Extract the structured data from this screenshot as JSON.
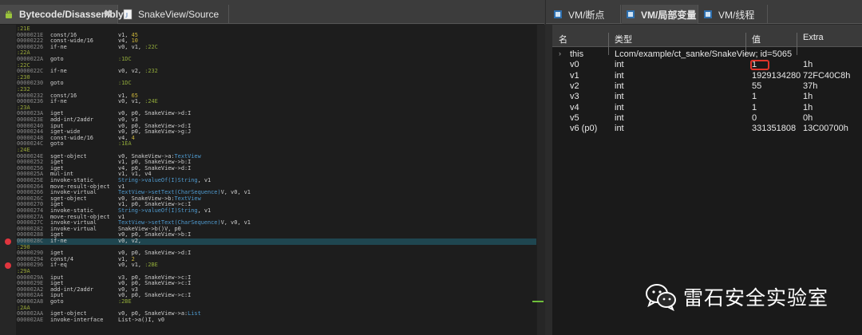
{
  "left_tabs": [
    {
      "label": "Bytecode/Disassembly",
      "active": true
    },
    {
      "label": "SnakeView/Source",
      "active": false
    }
  ],
  "code_lines": [
    {
      "type": "label",
      "text": ":21E"
    },
    {
      "addr": "0000021E",
      "op": "const/16",
      "args": [
        {
          "t": "v1, "
        },
        {
          "t": "45",
          "c": "k"
        }
      ]
    },
    {
      "addr": "00000222",
      "op": "const-wide/16",
      "args": [
        {
          "t": "v4, "
        },
        {
          "t": "10",
          "c": "k"
        }
      ]
    },
    {
      "addr": "00000226",
      "op": "if-ne",
      "args": [
        {
          "t": "v0, v1, "
        },
        {
          "t": ":22C",
          "c": "g"
        }
      ]
    },
    {
      "type": "label",
      "text": ":22A"
    },
    {
      "addr": "0000022A",
      "op": "goto",
      "args": [
        {
          "t": ":1DC",
          "c": "g"
        }
      ]
    },
    {
      "type": "label",
      "text": ":22C"
    },
    {
      "addr": "0000022C",
      "op": "if-ne",
      "args": [
        {
          "t": "v0, v2, "
        },
        {
          "t": ":232",
          "c": "g"
        }
      ]
    },
    {
      "type": "label",
      "text": ":230"
    },
    {
      "addr": "00000230",
      "op": "goto",
      "args": [
        {
          "t": ":1DC",
          "c": "g"
        }
      ]
    },
    {
      "type": "label",
      "text": ":232"
    },
    {
      "addr": "00000232",
      "op": "const/16",
      "args": [
        {
          "t": "v1, "
        },
        {
          "t": "65",
          "c": "k"
        }
      ]
    },
    {
      "addr": "00000236",
      "op": "if-ne",
      "args": [
        {
          "t": "v0, v1, "
        },
        {
          "t": ":24E",
          "c": "g"
        }
      ]
    },
    {
      "type": "label",
      "text": ":23A"
    },
    {
      "addr": "0000023A",
      "op": "iget",
      "args": [
        {
          "t": "v0, p0, SnakeView->d:I"
        }
      ]
    },
    {
      "addr": "0000023E",
      "op": "add-int/2addr",
      "args": [
        {
          "t": "v0, v3"
        }
      ]
    },
    {
      "addr": "00000240",
      "op": "iput",
      "args": [
        {
          "t": "v0, p0, SnakeView->d:I"
        }
      ]
    },
    {
      "addr": "00000244",
      "op": "iget-wide",
      "args": [
        {
          "t": "v0, p0, SnakeView->g:J"
        }
      ]
    },
    {
      "addr": "00000248",
      "op": "const-wide/16",
      "args": [
        {
          "t": "v4, "
        },
        {
          "t": "4",
          "c": "k"
        }
      ]
    },
    {
      "addr": "0000024C",
      "op": "goto",
      "args": [
        {
          "t": ":1EA",
          "c": "g"
        }
      ]
    },
    {
      "type": "label",
      "text": ":24E"
    },
    {
      "addr": "0000024E",
      "op": "sget-object",
      "args": [
        {
          "t": "v0, SnakeView->a:"
        },
        {
          "t": "TextView",
          "c": "m"
        }
      ]
    },
    {
      "addr": "00000252",
      "op": "iget",
      "args": [
        {
          "t": "v1, p0, SnakeView->b:I"
        }
      ]
    },
    {
      "addr": "00000256",
      "op": "iget",
      "args": [
        {
          "t": "v4, p0, SnakeView->d:I"
        }
      ]
    },
    {
      "addr": "0000025A",
      "op": "mul-int",
      "args": [
        {
          "t": "v1, v1, v4"
        }
      ]
    },
    {
      "addr": "0000025E",
      "op": "invoke-static",
      "args": [
        {
          "t": "String->valueOf(I)String",
          "c": "m"
        },
        {
          "t": ", v1"
        }
      ]
    },
    {
      "addr": "00000264",
      "op": "move-result-object",
      "args": [
        {
          "t": "v1"
        }
      ]
    },
    {
      "addr": "00000266",
      "op": "invoke-virtual",
      "args": [
        {
          "t": "TextView->setText(CharSequence)",
          "c": "m"
        },
        {
          "t": "V, v0, v1"
        }
      ]
    },
    {
      "addr": "0000026C",
      "op": "sget-object",
      "args": [
        {
          "t": "v0, SnakeView->b:"
        },
        {
          "t": "TextView",
          "c": "m"
        }
      ]
    },
    {
      "addr": "00000270",
      "op": "iget",
      "args": [
        {
          "t": "v1, p0, SnakeView->c:I"
        }
      ]
    },
    {
      "addr": "00000274",
      "op": "invoke-static",
      "args": [
        {
          "t": "String->valueOf(I)String",
          "c": "m"
        },
        {
          "t": ", v1"
        }
      ]
    },
    {
      "addr": "0000027A",
      "op": "move-result-object",
      "args": [
        {
          "t": "v1"
        }
      ]
    },
    {
      "addr": "0000027C",
      "op": "invoke-virtual",
      "args": [
        {
          "t": "TextView->setText(CharSequence)",
          "c": "m"
        },
        {
          "t": "V, v0, v1"
        }
      ]
    },
    {
      "addr": "00000282",
      "op": "invoke-virtual",
      "args": [
        {
          "t": "SnakeView->b()V, p0"
        }
      ]
    },
    {
      "addr": "00000288",
      "op": "iget",
      "args": [
        {
          "t": "v0, p0, SnakeView->b:I"
        }
      ]
    },
    {
      "addr": "0000028C",
      "op": "if-ne",
      "args": [
        {
          "t": "v0, v2, "
        }
      ],
      "hl": true,
      "bp": true
    },
    {
      "type": "label",
      "text": ":290"
    },
    {
      "addr": "00000290",
      "op": "iget",
      "args": [
        {
          "t": "v0, p0, SnakeView->d:I"
        }
      ]
    },
    {
      "addr": "00000294",
      "op": "const/4",
      "args": [
        {
          "t": "v1, "
        },
        {
          "t": "2",
          "c": "k"
        }
      ]
    },
    {
      "addr": "00000296",
      "op": "if-eq",
      "args": [
        {
          "t": "v0, v1, "
        },
        {
          "t": ":2BE",
          "c": "g"
        }
      ],
      "bp": true
    },
    {
      "type": "label",
      "text": ":29A"
    },
    {
      "addr": "0000029A",
      "op": "iput",
      "args": [
        {
          "t": "v3, p0, SnakeView->c:I"
        }
      ]
    },
    {
      "addr": "0000029E",
      "op": "iget",
      "args": [
        {
          "t": "v0, p0, SnakeView->c:I"
        }
      ]
    },
    {
      "addr": "000002A2",
      "op": "add-int/2addr",
      "args": [
        {
          "t": "v0, v3"
        }
      ]
    },
    {
      "addr": "000002A4",
      "op": "iput",
      "args": [
        {
          "t": "v0, p0, SnakeView->c:I"
        }
      ]
    },
    {
      "addr": "000002A8",
      "op": "goto",
      "args": [
        {
          "t": ":2BE",
          "c": "g"
        }
      ]
    },
    {
      "type": "label",
      "text": ":2AA"
    },
    {
      "addr": "000002AA",
      "op": "iget-object",
      "args": [
        {
          "t": "v0, p0, SnakeView->a:"
        },
        {
          "t": "List",
          "c": "m"
        }
      ]
    },
    {
      "addr": "000002AE",
      "op": "invoke-interface",
      "args": [
        {
          "t": "List->a()I, v0"
        }
      ]
    }
  ],
  "right_tabs": [
    {
      "label": "VM/断点",
      "active": false
    },
    {
      "label": "VM/局部变量",
      "active": true
    },
    {
      "label": "VM/线程",
      "active": false
    }
  ],
  "var_headers": {
    "name": "名",
    "type": "类型",
    "value": "值",
    "extra": "Extra"
  },
  "variables": [
    {
      "name": "this",
      "type": "Lcom/example/ct_sanke/SnakeView; id=5065",
      "value": "",
      "extra": "",
      "expander": true
    },
    {
      "name": "v0",
      "type": "int",
      "value": "1",
      "extra": "1h"
    },
    {
      "name": "v1",
      "type": "int",
      "value": "1929134280",
      "extra": "72FC40C8h"
    },
    {
      "name": "v2",
      "type": "int",
      "value": "55",
      "extra": "37h"
    },
    {
      "name": "v3",
      "type": "int",
      "value": "1",
      "extra": "1h"
    },
    {
      "name": "v4",
      "type": "int",
      "value": "1",
      "extra": "1h"
    },
    {
      "name": "v5",
      "type": "int",
      "value": "0",
      "extra": "0h"
    },
    {
      "name": "v6 (p0)",
      "type": "int",
      "value": "331351808",
      "extra": "13C00700h"
    }
  ],
  "watermark": {
    "text": "雷石安全实验室",
    "icon": "wechat-icon"
  },
  "colors": {
    "highlight": "#1f4650",
    "breakpoint": "#e0353e",
    "label": "#9aa93a",
    "annotation_box": "#e0352a"
  }
}
